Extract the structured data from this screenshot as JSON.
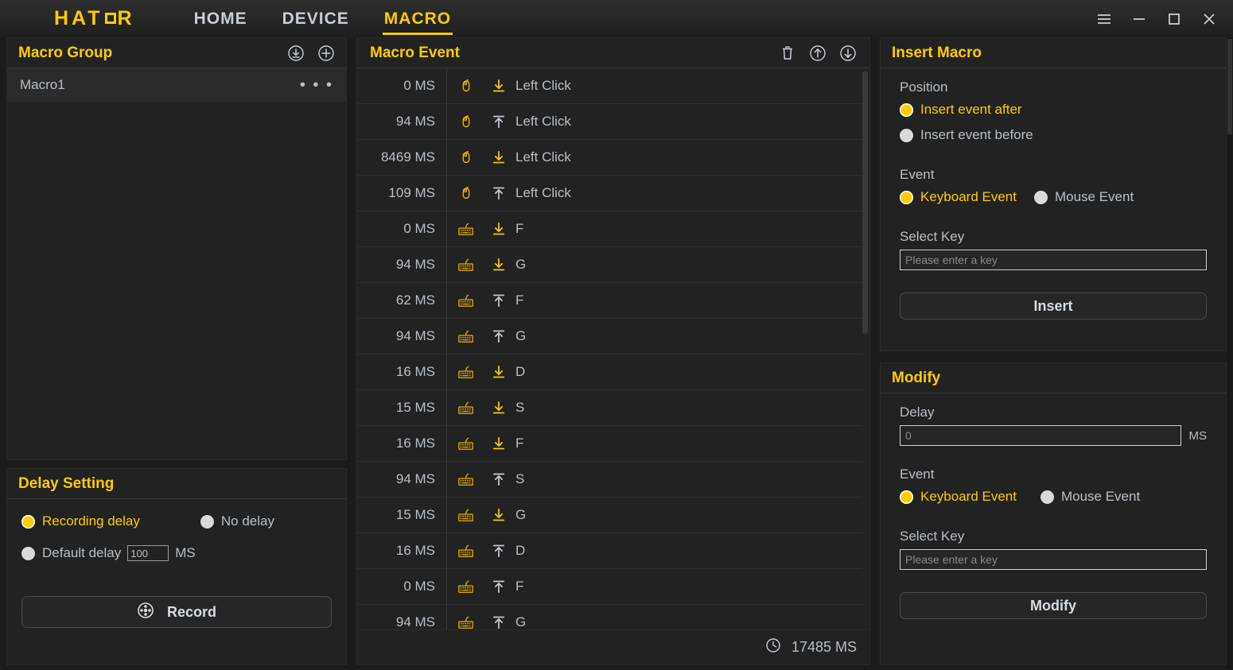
{
  "titlebar": {
    "brand": "HATOR",
    "nav": [
      {
        "label": "HOME",
        "active": false
      },
      {
        "label": "DEVICE",
        "active": false
      },
      {
        "label": "MACRO",
        "active": true
      }
    ],
    "window_controls": [
      "menu-icon",
      "minimize-icon",
      "maximize-icon",
      "close-icon"
    ]
  },
  "macro_group": {
    "title": "Macro Group",
    "icons": [
      "download-icon",
      "add-icon"
    ],
    "items": [
      {
        "name": "Macro1",
        "selected": true,
        "menu": "• • •"
      }
    ]
  },
  "delay_setting": {
    "title": "Delay Setting",
    "options": [
      {
        "label": "Recording delay",
        "selected": true
      },
      {
        "label": "No delay",
        "selected": false
      },
      {
        "label": "Default delay",
        "selected": false
      }
    ],
    "default_delay_value": "100",
    "unit": "MS",
    "record_button": "Record"
  },
  "macro_event": {
    "title": "Macro Event",
    "icons": [
      "trash-icon",
      "move-up-icon",
      "move-down-icon"
    ],
    "total_label": "17485 MS",
    "rows": [
      {
        "time": "0 MS",
        "device": "mouse",
        "dir": "down",
        "name": "Left Click"
      },
      {
        "time": "94 MS",
        "device": "mouse",
        "dir": "up",
        "name": "Left Click"
      },
      {
        "time": "8469 MS",
        "device": "mouse",
        "dir": "down",
        "name": "Left Click"
      },
      {
        "time": "109 MS",
        "device": "mouse",
        "dir": "up",
        "name": "Left Click"
      },
      {
        "time": "0 MS",
        "device": "keyboard",
        "dir": "down",
        "name": "F"
      },
      {
        "time": "94 MS",
        "device": "keyboard",
        "dir": "down",
        "name": "G"
      },
      {
        "time": "62 MS",
        "device": "keyboard",
        "dir": "up",
        "name": "F"
      },
      {
        "time": "94 MS",
        "device": "keyboard",
        "dir": "up",
        "name": "G"
      },
      {
        "time": "16 MS",
        "device": "keyboard",
        "dir": "down",
        "name": "D"
      },
      {
        "time": "15 MS",
        "device": "keyboard",
        "dir": "down",
        "name": "S"
      },
      {
        "time": "16 MS",
        "device": "keyboard",
        "dir": "down",
        "name": "F"
      },
      {
        "time": "94 MS",
        "device": "keyboard",
        "dir": "up",
        "name": "S"
      },
      {
        "time": "15 MS",
        "device": "keyboard",
        "dir": "down",
        "name": "G"
      },
      {
        "time": "16 MS",
        "device": "keyboard",
        "dir": "up",
        "name": "D"
      },
      {
        "time": "0 MS",
        "device": "keyboard",
        "dir": "up",
        "name": "F"
      },
      {
        "time": "94 MS",
        "device": "keyboard",
        "dir": "up",
        "name": "G"
      }
    ]
  },
  "insert_macro": {
    "title": "Insert Macro",
    "position_label": "Position",
    "position_options": [
      {
        "label": "Insert event after",
        "selected": true
      },
      {
        "label": "Insert event before",
        "selected": false
      }
    ],
    "event_label": "Event",
    "event_options": [
      {
        "label": "Keyboard Event",
        "selected": true
      },
      {
        "label": "Mouse Event",
        "selected": false
      }
    ],
    "select_key_label": "Select Key",
    "key_placeholder": "Please enter a key",
    "key_value": "",
    "button": "Insert"
  },
  "modify": {
    "title": "Modify",
    "delay_label": "Delay",
    "delay_placeholder": "0",
    "delay_value": "",
    "delay_unit": "MS",
    "event_label": "Event",
    "event_options": [
      {
        "label": "Keyboard Event",
        "selected": true
      },
      {
        "label": "Mouse Event",
        "selected": false
      }
    ],
    "select_key_label": "Select Key",
    "key_placeholder": "Please enter a key",
    "key_value": "",
    "button": "Modify"
  },
  "colors": {
    "accent": "#ffcc00",
    "text": "#b9bfc6",
    "panel_bg": "#222222",
    "app_bg": "#1c1c1c"
  }
}
